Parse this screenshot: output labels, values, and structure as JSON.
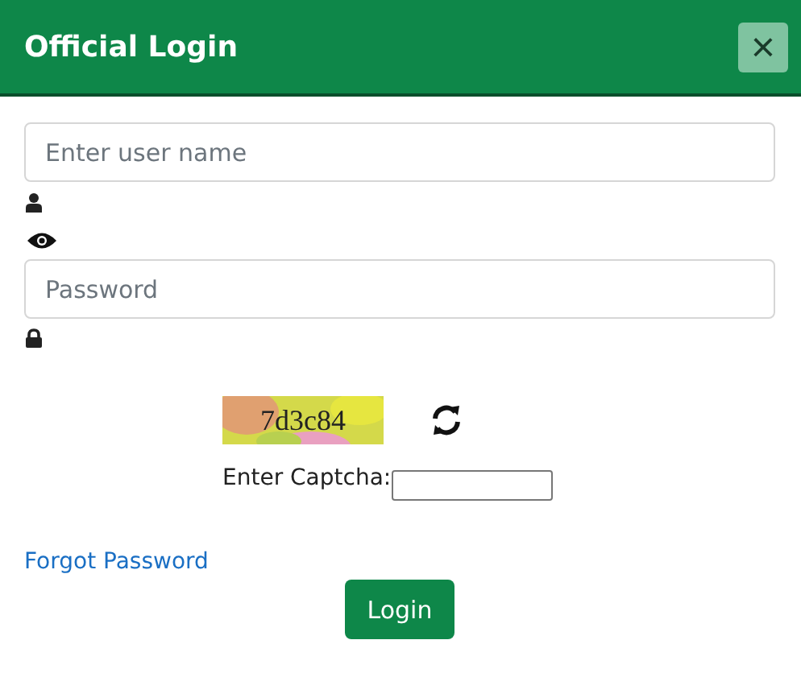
{
  "window": {
    "title": "Official Login",
    "close_label": "×"
  },
  "username": {
    "placeholder": "Enter user name"
  },
  "password": {
    "placeholder": "Password"
  },
  "captcha": {
    "code": "7d3c84",
    "label": "Enter Captcha:"
  },
  "forgot_link": "Forgot Password",
  "login_button": "Login"
}
